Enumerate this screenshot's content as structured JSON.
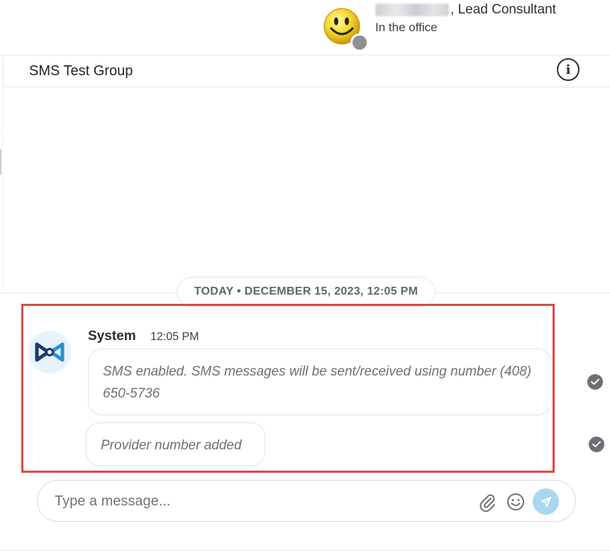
{
  "user": {
    "name_suffix": ", Lead Consultant",
    "status": "In the office",
    "avatar_icon": "smiley-face-icon",
    "presence_color": "#8e9194"
  },
  "conversation": {
    "title": "SMS Test Group",
    "info_icon": "info-icon",
    "info_glyph": "i"
  },
  "date_separator": "TODAY • DECEMBER 15, 2023, 12:05 PM",
  "message": {
    "sender": "System",
    "time": "12:05 PM",
    "avatar_icon": "system-logo-icon",
    "bubbles": [
      "SMS enabled. SMS messages will be sent/received using number (408) 650-5736",
      "Provider number added"
    ]
  },
  "composer": {
    "placeholder": "Type a message...",
    "attach_icon": "paperclip-icon",
    "emoji_icon": "smiley-icon",
    "send_icon": "send-icon"
  },
  "colors": {
    "highlight": "#e04545",
    "send_button": "#a9d7f0",
    "system_logo_dark": "#1b3a6b",
    "system_logo_light": "#2a8fd0"
  }
}
